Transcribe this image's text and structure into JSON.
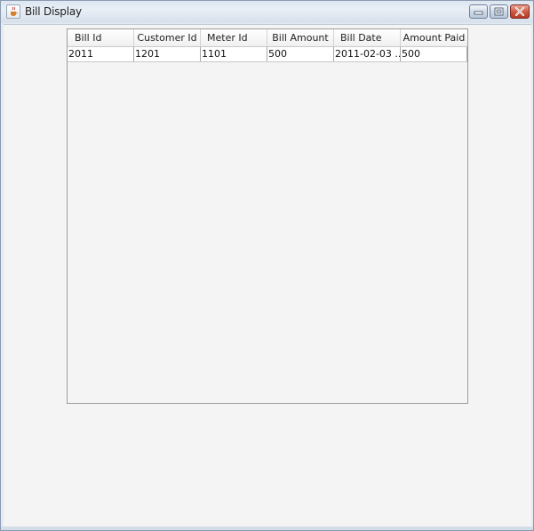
{
  "window": {
    "title": "Bill Display"
  },
  "icons": {
    "app": "java-cup-icon",
    "minimize": "minimize-icon",
    "maximize": "maximize-icon",
    "close": "close-icon"
  },
  "table": {
    "columns": [
      "Bill Id",
      "Customer Id",
      "Meter Id",
      "Bill Amount",
      "Bill Date",
      "Amount Paid"
    ],
    "rows": [
      [
        "2011",
        "1201",
        "1101",
        "500",
        "2011-02-03 ...",
        "500"
      ]
    ]
  },
  "colors": {
    "close_button": "#cf5a44",
    "client_background": "#f4f4f4"
  }
}
